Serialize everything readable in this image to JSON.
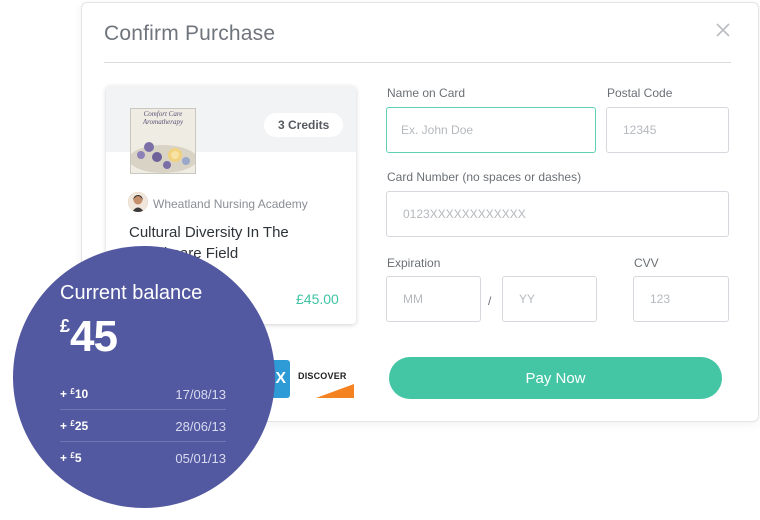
{
  "modal": {
    "title": "Confirm Purchase",
    "close_icon": "close-icon"
  },
  "product": {
    "thumbnail_title": "Comfort Care Aromatherapy",
    "credits": "3 Credits",
    "provider": "Wheatland Nursing Academy",
    "course_title": "Cultural Diversity In The Healthcare Field",
    "price": "£45.00"
  },
  "form": {
    "name_label": "Name on Card",
    "name_placeholder": "Ex. John Doe",
    "postal_label": "Postal Code",
    "postal_placeholder": "12345",
    "card_label": "Card Number (no spaces or dashes)",
    "card_placeholder": "0123XXXXXXXXXXXX",
    "expiration_label": "Expiration",
    "month_placeholder": "MM",
    "year_placeholder": "YY",
    "separator": "/",
    "cvv_label": "CVV",
    "cvv_placeholder": "123"
  },
  "payment_icons": {
    "amex_glyph": "X",
    "discover_label": "DISCOVER"
  },
  "pay_button": "Pay Now",
  "balance": {
    "label": "Current balance",
    "currency": "£",
    "amount": "45",
    "transactions": [
      {
        "sign": "+",
        "currency": "£",
        "amount": "10",
        "date": "17/08/13"
      },
      {
        "sign": "+",
        "currency": "£",
        "amount": "25",
        "date": "28/06/13"
      },
      {
        "sign": "+",
        "currency": "£",
        "amount": "5",
        "date": "05/01/13"
      }
    ]
  },
  "colors": {
    "accent": "#44c6a5",
    "balance_bg": "#5359a0",
    "amex": "#2e9bd6",
    "discover_orange": "#f58220"
  }
}
